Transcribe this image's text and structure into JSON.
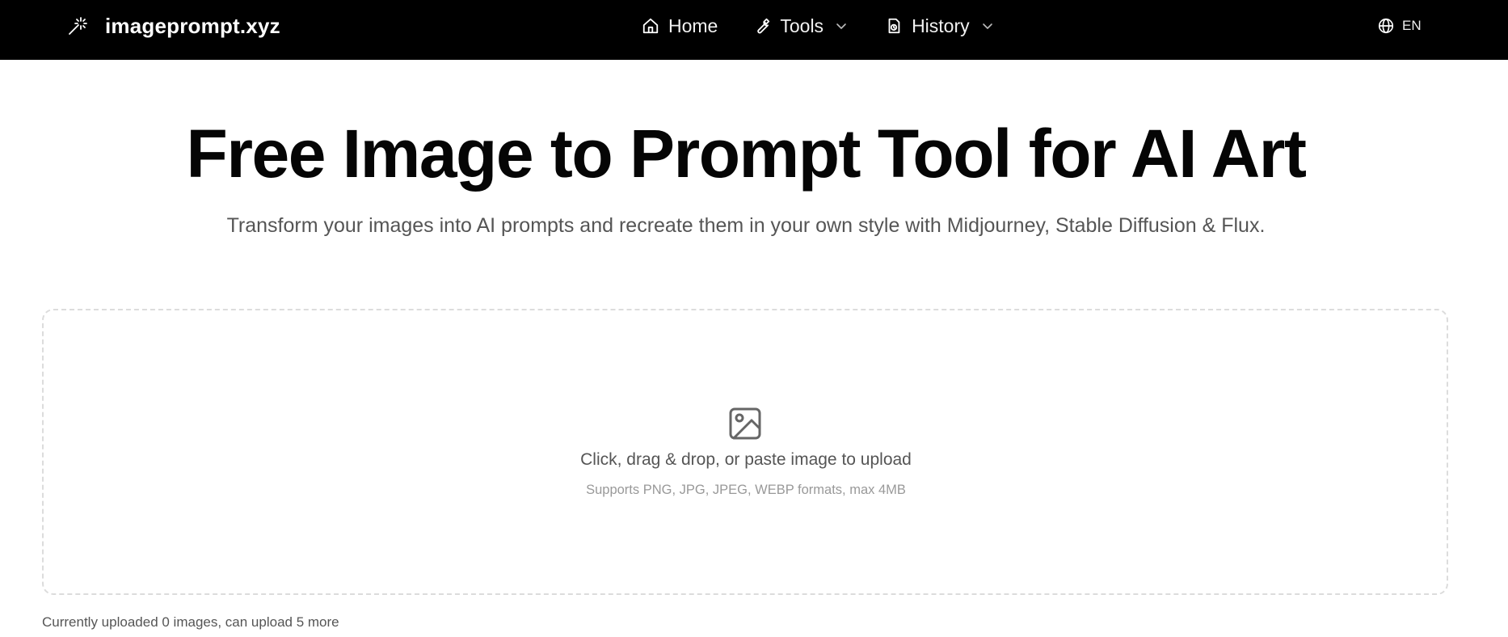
{
  "header": {
    "brand": "imageprompt.xyz",
    "brand_icon": "magic-wand-icon",
    "nav": [
      {
        "label": "Home",
        "icon": "home-icon"
      },
      {
        "label": "Tools",
        "icon": "wrench-icon",
        "has_dropdown": true
      },
      {
        "label": "History",
        "icon": "history-icon",
        "has_dropdown": true
      }
    ],
    "language": {
      "label": "EN",
      "icon": "globe-icon"
    }
  },
  "hero": {
    "title": "Free Image to Prompt Tool for AI Art",
    "subtitle": "Transform your images into AI prompts and recreate them in your own style with Midjourney, Stable Diffusion & Flux."
  },
  "upload": {
    "icon": "image-icon",
    "prompt": "Click, drag & drop, or paste image to upload",
    "hint": "Supports PNG, JPG, JPEG, WEBP formats, max 4MB",
    "status": "Currently uploaded 0 images, can upload 5 more"
  },
  "colors": {
    "header_bg": "#000000",
    "header_text": "#ffffff",
    "dropzone_border": "#dcdcdc"
  }
}
